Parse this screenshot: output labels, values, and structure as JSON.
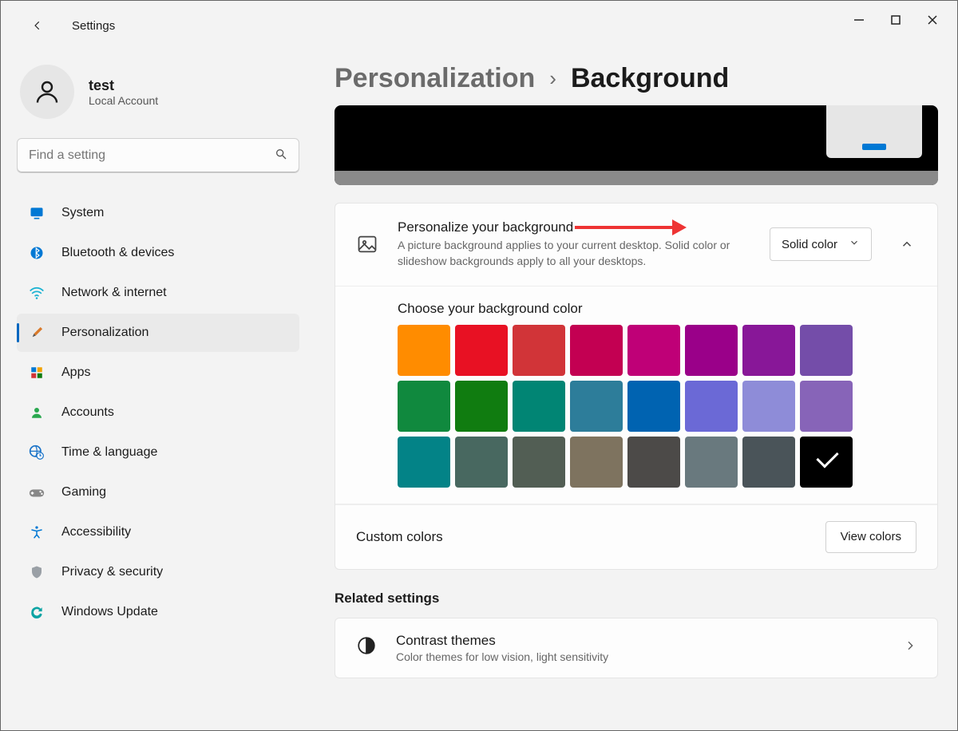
{
  "app": {
    "title": "Settings"
  },
  "account": {
    "name": "test",
    "subtitle": "Local Account"
  },
  "search": {
    "placeholder": "Find a setting"
  },
  "sidebar": {
    "items": [
      {
        "label": "System",
        "icon": "monitor",
        "active": false
      },
      {
        "label": "Bluetooth & devices",
        "icon": "bluetooth",
        "active": false
      },
      {
        "label": "Network & internet",
        "icon": "wifi",
        "active": false
      },
      {
        "label": "Personalization",
        "icon": "brush",
        "active": true
      },
      {
        "label": "Apps",
        "icon": "apps",
        "active": false
      },
      {
        "label": "Accounts",
        "icon": "person",
        "active": false
      },
      {
        "label": "Time & language",
        "icon": "globe-clock",
        "active": false
      },
      {
        "label": "Gaming",
        "icon": "gamepad",
        "active": false
      },
      {
        "label": "Accessibility",
        "icon": "accessibility",
        "active": false
      },
      {
        "label": "Privacy & security",
        "icon": "shield",
        "active": false
      },
      {
        "label": "Windows Update",
        "icon": "update",
        "active": false
      }
    ]
  },
  "breadcrumb": {
    "parent": "Personalization",
    "current": "Background"
  },
  "background_setting": {
    "title": "Personalize your background",
    "description": "A picture background applies to your current desktop. Solid color or slideshow backgrounds apply to all your desktops.",
    "selected_option": "Solid color"
  },
  "colors": {
    "title": "Choose your background color",
    "swatches": [
      {
        "hex": "#ff8c00",
        "selected": false
      },
      {
        "hex": "#e81123",
        "selected": false
      },
      {
        "hex": "#d13438",
        "selected": false
      },
      {
        "hex": "#c30052",
        "selected": false
      },
      {
        "hex": "#bf0077",
        "selected": false
      },
      {
        "hex": "#9a0089",
        "selected": false
      },
      {
        "hex": "#881798",
        "selected": false
      },
      {
        "hex": "#744da9",
        "selected": false
      },
      {
        "hex": "#10893e",
        "selected": false
      },
      {
        "hex": "#107c10",
        "selected": false
      },
      {
        "hex": "#018574",
        "selected": false
      },
      {
        "hex": "#2d7d9a",
        "selected": false
      },
      {
        "hex": "#0063b1",
        "selected": false
      },
      {
        "hex": "#6b69d6",
        "selected": false
      },
      {
        "hex": "#8e8cd8",
        "selected": false
      },
      {
        "hex": "#8764b8",
        "selected": false
      },
      {
        "hex": "#038387",
        "selected": false
      },
      {
        "hex": "#486860",
        "selected": false
      },
      {
        "hex": "#525e54",
        "selected": false
      },
      {
        "hex": "#7e735f",
        "selected": false
      },
      {
        "hex": "#4c4a48",
        "selected": false
      },
      {
        "hex": "#69797e",
        "selected": false
      },
      {
        "hex": "#4a5459",
        "selected": false
      },
      {
        "hex": "#000000",
        "selected": true
      }
    ]
  },
  "custom_colors": {
    "label": "Custom colors",
    "button": "View colors"
  },
  "related": {
    "heading": "Related settings",
    "item": {
      "title": "Contrast themes",
      "subtitle": "Color themes for low vision, light sensitivity"
    }
  }
}
